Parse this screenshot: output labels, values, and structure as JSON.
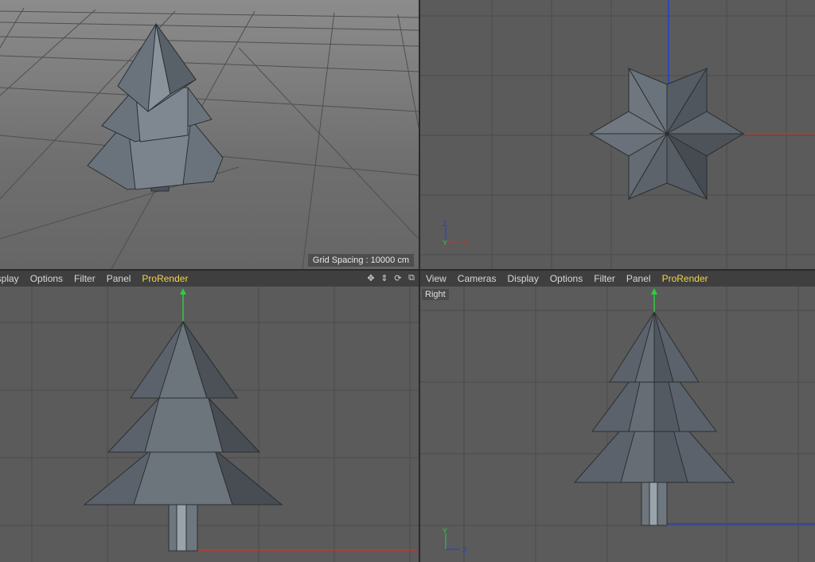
{
  "perspective": {
    "grid_label": "Grid Spacing : 10000 cm"
  },
  "top_view": {
    "axis_labels": {
      "z": "Z",
      "y": "Y",
      "x": "X"
    }
  },
  "front_view": {
    "menu": [
      "isplay",
      "Options",
      "Filter",
      "Panel",
      "ProRender"
    ],
    "nav_icons": [
      "move-view-icon",
      "dolly-icon",
      "rotate-view-icon",
      "maximize-view-icon"
    ]
  },
  "right_view": {
    "menu": [
      "View",
      "Cameras",
      "Display",
      "Options",
      "Filter",
      "Panel",
      "ProRender"
    ],
    "view_name": "Right",
    "axis_labels": {
      "y": "Y",
      "z": "Z"
    }
  },
  "colors": {
    "highlight_menu": "#f2d44a",
    "x_axis": "#c0392b",
    "y_axis": "#2ecc40",
    "z_axis": "#1f3fd6",
    "mesh": "#5b626b"
  }
}
